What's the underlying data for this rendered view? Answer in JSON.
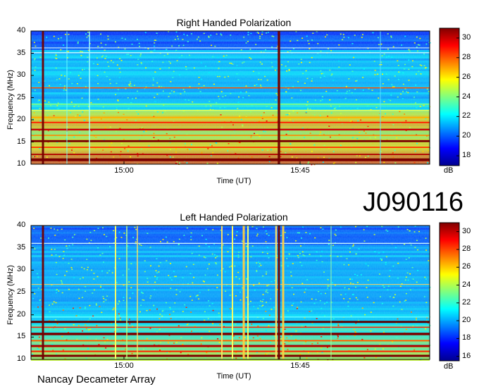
{
  "observation_id": "J090116",
  "footer": "Nancay Decameter Array",
  "chart_data": [
    {
      "type": "heatmap",
      "title": "Right Handed Polarization",
      "xlabel": "Time (UT)",
      "ylabel": "Frequency (MHz)",
      "x_ticks": [
        "15:00",
        "15:45"
      ],
      "y_ticks": [
        10,
        15,
        20,
        25,
        30,
        35,
        40
      ],
      "ylim": [
        10,
        40
      ],
      "colorbar": {
        "label": "dB",
        "ticks": [
          18,
          20,
          22,
          24,
          26,
          28,
          30
        ],
        "range": [
          17,
          31
        ]
      }
    },
    {
      "type": "heatmap",
      "title": "Left Handed Polarization",
      "xlabel": "Time (UT)",
      "ylabel": "Frequency (MHz)",
      "x_ticks": [
        "15:00",
        "15:45"
      ],
      "y_ticks": [
        10,
        15,
        20,
        25,
        30,
        35,
        40
      ],
      "ylim": [
        10,
        40
      ],
      "colorbar": {
        "label": "dB",
        "ticks": [
          16,
          18,
          20,
          22,
          24,
          26,
          28,
          30
        ],
        "range": [
          15.5,
          31
        ]
      }
    }
  ]
}
